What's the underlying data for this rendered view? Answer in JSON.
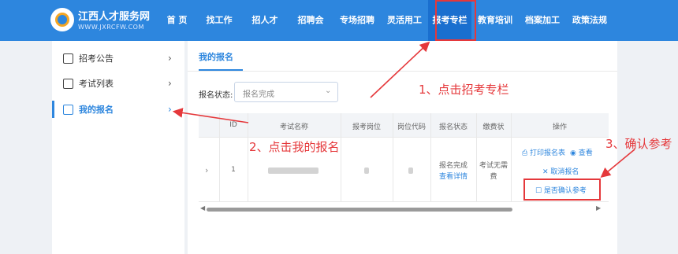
{
  "site": {
    "title": "江西人才服务网",
    "subtitle": "WWW.JXRCFW.COM"
  },
  "nav": [
    "首 页",
    "找工作",
    "招人才",
    "招聘会",
    "专场招聘",
    "灵活用工",
    "报考专栏",
    "教育培训",
    "档案加工",
    "政策法规"
  ],
  "sidebar": {
    "items": [
      {
        "label": "招考公告",
        "arrow": "›"
      },
      {
        "label": "考试列表",
        "arrow": "›"
      },
      {
        "label": "我的报名",
        "arrow": "›"
      }
    ]
  },
  "main": {
    "tab": "我的报名",
    "filter": {
      "label": "报名状态:",
      "value": "报名完成",
      "chevron": "⌄"
    },
    "table": {
      "headers": [
        "ID",
        "考试名称",
        "报考岗位",
        "岗位代码",
        "报名状态",
        "缴费状",
        "操作"
      ],
      "row": {
        "expand": "›",
        "id": "1",
        "status": "报名完成",
        "status_link": "查看详情",
        "pay_line1": "考试无需",
        "pay_line2": "费"
      },
      "ops": {
        "print": "⎙ 打印报名表",
        "view": "◉ 查看",
        "cancel": "✕ 取消报名",
        "confirm": "☐ 是否确认参考"
      },
      "scroll_left": "◀",
      "scroll_right": "▶"
    }
  },
  "annotations": {
    "step1": "1、点击招考专栏",
    "step2": "2、点击我的报名",
    "step3": "3、确认参考"
  },
  "colors": {
    "header": "#2d86de",
    "accent": "#2d86de",
    "annotation": "#e5383b"
  }
}
